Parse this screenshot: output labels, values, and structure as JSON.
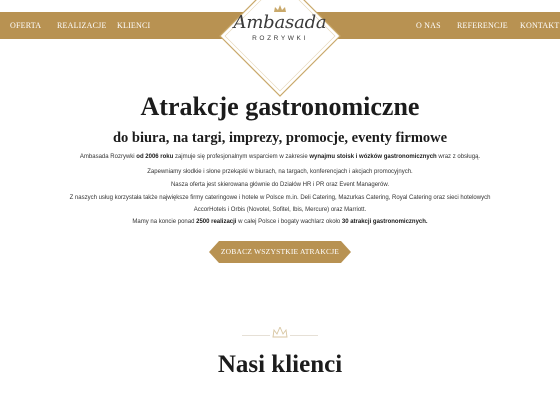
{
  "nav": {
    "left": [
      "OFERTA",
      "REALIZACJE",
      "KLIENCI"
    ],
    "right": [
      "O NAS",
      "REFERENCJE",
      "KONTAKT"
    ]
  },
  "logo": {
    "name": "Ambasada",
    "tagline": "ROZRYWKI"
  },
  "hero": {
    "title": "Atrakcje gastronomiczne",
    "subtitle": "do biura, na targi, imprezy, promocje, eventy firmowe",
    "lines": [
      [
        {
          "t": "Ambasada Rozrywki ",
          "b": false
        },
        {
          "t": "od 2006 roku",
          "b": true
        },
        {
          "t": " zajmuje się profesjonalnym wsparciem w zakresie ",
          "b": false
        },
        {
          "t": "wynajmu stoisk i wózków gastronomicznych",
          "b": true
        },
        {
          "t": " wraz z obsługą.",
          "b": false
        }
      ],
      [
        {
          "t": "Zapewniamy słodkie i słone przekąski w biurach, na targach, konferencjach i akcjach promocyjnych.",
          "b": false
        }
      ],
      [
        {
          "t": "Nasza oferta jest skierowana głównie do Działów HR i PR oraz Event Managerów.",
          "b": false
        }
      ],
      [
        {
          "t": "Z naszych usług korzystała także największe firmy cateringowe i hotele w Polsce m.in. Deli Catering, Mazurkas Catering, Royal Catering oraz sieci hotelowych",
          "b": false
        }
      ],
      [
        {
          "t": "AccorHotels i Orbis (Novotel, Sofitel, Ibis, Mercure) oraz Marriott.",
          "b": false
        }
      ],
      [
        {
          "t": "Mamy na koncie ponad ",
          "b": false
        },
        {
          "t": "2500 realizacji",
          "b": true
        },
        {
          "t": " w całej Polsce i bogaty wachlarz około ",
          "b": false
        },
        {
          "t": "30 atrakcji gastronomicznych.",
          "b": true
        }
      ]
    ],
    "cta_label": "ZOBACZ WSZYSTKIE ATRAKCJE"
  },
  "clients": {
    "title": "Nasi klienci"
  },
  "colors": {
    "gold": "#b89252",
    "divider": "#e6e0d6",
    "crown": "#c9a96b"
  }
}
